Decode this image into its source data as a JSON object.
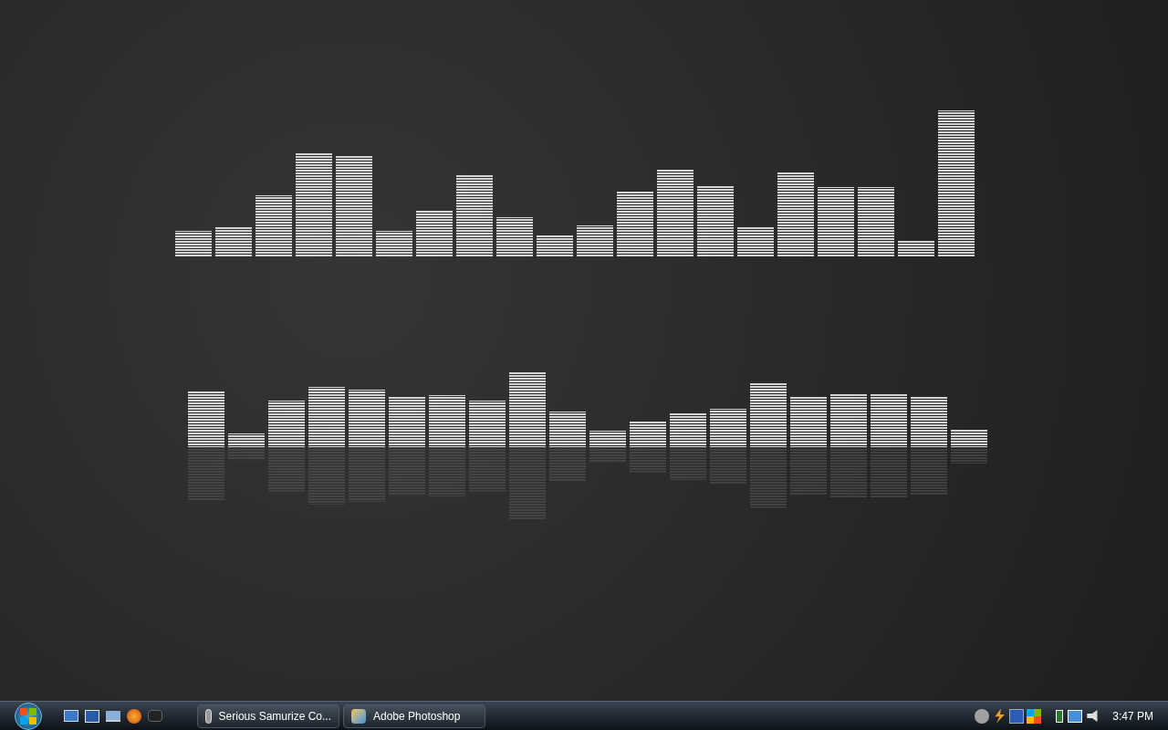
{
  "taskbar": {
    "tasks": [
      {
        "label": "Serious Samurize Co..."
      },
      {
        "label": "Adobe Photoshop"
      }
    ],
    "clock": "3:47 PM"
  }
}
